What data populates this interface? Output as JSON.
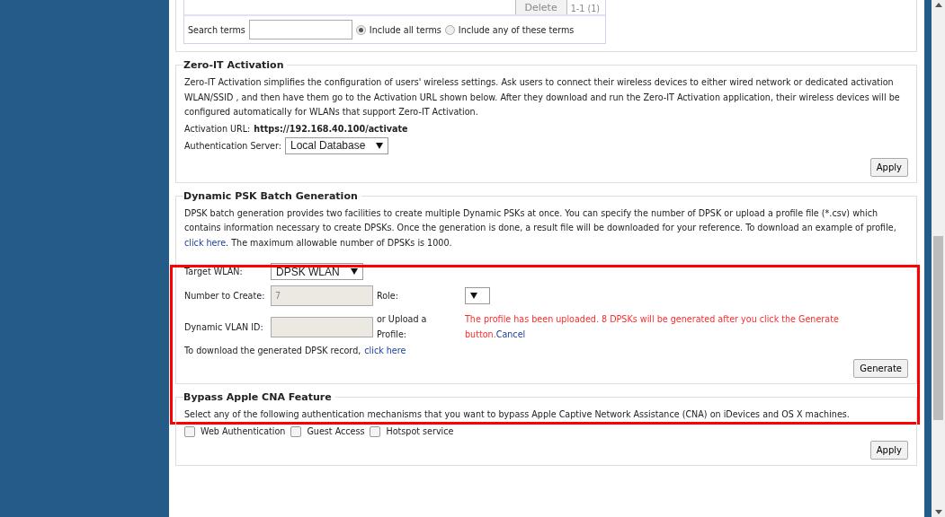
{
  "top_panel": {
    "delete_button": "Delete",
    "pager": "1-1 (1)",
    "search_label": "Search terms",
    "match_options": [
      {
        "label": "Include all terms",
        "selected": true
      },
      {
        "label": "Include any of these terms",
        "selected": false
      }
    ]
  },
  "zero_it": {
    "title": "Zero-IT Activation",
    "description": "Zero-IT Activation simplifies the configuration of users' wireless settings. Ask users to connect their wireless devices to either wired network or dedicated activation WLAN/SSID , and then have them go to the Activation URL shown below. After they download and run the Zero-IT Activation application, their wireless devices will be configured automatically for WLANs that support Zero-IT Activation.",
    "url_label": "Activation URL:",
    "url": "https://192.168.40.100/activate",
    "auth_label": "Authentication Server:",
    "auth_value": "Local Database",
    "apply": "Apply"
  },
  "dpsk": {
    "title": "Dynamic PSK Batch Generation",
    "description_before": "DPSK batch generation provides two facilities to create multiple Dynamic PSKs at once. You can specify the number of DPSK or upload a profile file (*.csv) which contains information necessary to create DPSKs. Once the generation is done, a result file will be downloaded for your reference. To download an example of profile,",
    "description_link": "click here",
    "description_after": ". The maximum allowable number of DPSKs is 1000.",
    "target_label": "Target WLAN:",
    "target_value": "DPSK WLAN",
    "number_label": "Number to Create:",
    "number_value": "7",
    "role_label": "Role:",
    "vlan_label": "Dynamic VLAN ID:",
    "upload_label": "or Upload a Profile:",
    "upload_message": "The profile has been uploaded. 8 DPSKs will be generated after you click the Generate button.",
    "cancel": "Cancel",
    "download_text": "To download the generated DPSK record,",
    "download_link": "click here",
    "generate": "Generate"
  },
  "bypass": {
    "title": "Bypass Apple CNA Feature",
    "description": "Select any of the following authentication mechanisms that you want to bypass Apple Captive Network Assistance (CNA) on iDevices and OS X machines.",
    "options": [
      {
        "label": "Web Authentication",
        "checked": false
      },
      {
        "label": "Guest Access",
        "checked": false
      },
      {
        "label": "Hotspot service",
        "checked": false
      }
    ],
    "apply": "Apply"
  }
}
